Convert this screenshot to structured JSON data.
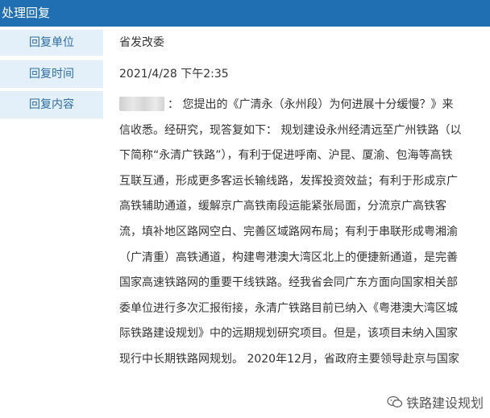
{
  "header": {
    "title": "处理回复"
  },
  "fields": {
    "unit_label": "回复单位",
    "unit_value": "省发改委",
    "time_label": "回复时间",
    "time_value": "2021/4/28 下午2:35",
    "content_label": "回复内容"
  },
  "content_lines": [
    "：  您提出的《广清永（永州段）为何进展十分缓慢？》来",
    "信收悉。经研究，现答复如下：  规划建设永州经清远至广州铁路（以",
    "下简称“永清广铁路”），有利于促进呼南、沪昆、厦渝、包海等高铁",
    "互联互通，形成更多客运长输线路，发挥投资效益；有利于形成京广",
    "高铁辅助通道，缓解京广高铁南段运能紧张局面，分流京广高铁客",
    "流，填补地区路网空白、完善区域路网布局；有利于串联形成粤湘渝",
    "（广清重）高铁通道，构建粤港澳大湾区北上的便捷新通道，是完善",
    "国家高速铁路网的重要干线铁路。经我省会同广东方面向国家相关部",
    "委单位进行多次汇报衔接，永清广铁路目前已纳入《粤港澳大湾区城",
    "际铁路建设规划》中的远期规划研究项目。但是，该项目未纳入国家",
    "现行中长期铁路网规划。 2020年12月，省政府主要领导赴京与国家"
  ],
  "watermark": {
    "text": "铁路建设规划",
    "icon": "wechat-icon"
  }
}
